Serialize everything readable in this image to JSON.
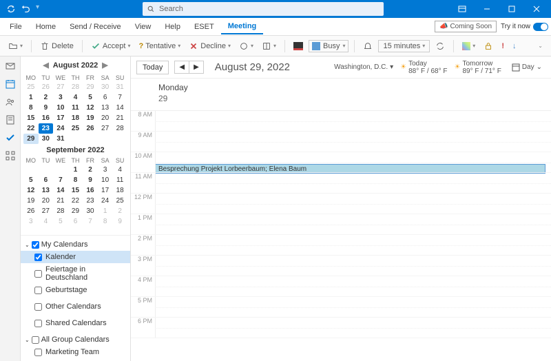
{
  "titlebar": {
    "search_placeholder": "Search"
  },
  "menubar": {
    "items": [
      "File",
      "Home",
      "Send / Receive",
      "View",
      "Help",
      "ESET",
      "Meeting"
    ],
    "active": "Meeting",
    "coming_soon": "Coming Soon",
    "try_it": "Try it now"
  },
  "ribbon": {
    "delete": "Delete",
    "accept": "Accept",
    "tentative": "Tentative",
    "decline": "Decline",
    "busy": "Busy",
    "reminder": "15 minutes"
  },
  "calendar": {
    "month1_title": "August 2022",
    "month2_title": "September 2022",
    "weekdays": [
      "MO",
      "TU",
      "WE",
      "TH",
      "FR",
      "SA",
      "SU"
    ],
    "month1_weeks": [
      [
        {
          "n": 25,
          "o": 1
        },
        {
          "n": 26,
          "o": 1
        },
        {
          "n": 27,
          "o": 1
        },
        {
          "n": 28,
          "o": 1
        },
        {
          "n": 29,
          "o": 1
        },
        {
          "n": 30,
          "o": 1
        },
        {
          "n": 31,
          "o": 1
        }
      ],
      [
        {
          "n": 1,
          "b": 1
        },
        {
          "n": 2,
          "b": 1
        },
        {
          "n": 3,
          "b": 1
        },
        {
          "n": 4,
          "b": 1
        },
        {
          "n": 5,
          "b": 1
        },
        {
          "n": 6
        },
        {
          "n": 7
        }
      ],
      [
        {
          "n": 8,
          "b": 1
        },
        {
          "n": 9,
          "b": 1
        },
        {
          "n": 10,
          "b": 1
        },
        {
          "n": 11,
          "b": 1
        },
        {
          "n": 12,
          "b": 1
        },
        {
          "n": 13
        },
        {
          "n": 14
        }
      ],
      [
        {
          "n": 15,
          "b": 1
        },
        {
          "n": 16,
          "b": 1
        },
        {
          "n": 17,
          "b": 1
        },
        {
          "n": 18,
          "b": 1
        },
        {
          "n": 19,
          "b": 1
        },
        {
          "n": 20
        },
        {
          "n": 21
        }
      ],
      [
        {
          "n": 22,
          "b": 1
        },
        {
          "n": 23,
          "b": 1,
          "t": 1
        },
        {
          "n": 24,
          "b": 1
        },
        {
          "n": 25,
          "b": 1
        },
        {
          "n": 26,
          "b": 1
        },
        {
          "n": 27
        },
        {
          "n": 28
        }
      ],
      [
        {
          "n": 29,
          "b": 1,
          "s": 1
        },
        {
          "n": 30,
          "b": 1
        },
        {
          "n": 31,
          "b": 1
        },
        {
          "n": "",
          "o": 1
        },
        {
          "n": "",
          "o": 1
        },
        {
          "n": "",
          "o": 1
        },
        {
          "n": "",
          "o": 1
        }
      ]
    ],
    "month2_weeks": [
      [
        {
          "n": "",
          "o": 1
        },
        {
          "n": "",
          "o": 1
        },
        {
          "n": "",
          "o": 1
        },
        {
          "n": 1,
          "b": 1
        },
        {
          "n": 2,
          "b": 1
        },
        {
          "n": 3
        },
        {
          "n": 4
        }
      ],
      [
        {
          "n": 5,
          "b": 1
        },
        {
          "n": 6,
          "b": 1
        },
        {
          "n": 7,
          "b": 1
        },
        {
          "n": 8,
          "b": 1
        },
        {
          "n": 9,
          "b": 1
        },
        {
          "n": 10
        },
        {
          "n": 11
        }
      ],
      [
        {
          "n": 12,
          "b": 1
        },
        {
          "n": 13,
          "b": 1
        },
        {
          "n": 14,
          "b": 1
        },
        {
          "n": 15,
          "b": 1
        },
        {
          "n": 16,
          "b": 1
        },
        {
          "n": 17
        },
        {
          "n": 18
        }
      ],
      [
        {
          "n": 19
        },
        {
          "n": 20
        },
        {
          "n": 21
        },
        {
          "n": 22
        },
        {
          "n": 23
        },
        {
          "n": 24
        },
        {
          "n": 25
        }
      ],
      [
        {
          "n": 26
        },
        {
          "n": 27
        },
        {
          "n": 28
        },
        {
          "n": 29
        },
        {
          "n": 30
        },
        {
          "n": 1,
          "o": 1
        },
        {
          "n": 2,
          "o": 1
        }
      ],
      [
        {
          "n": 3,
          "o": 1
        },
        {
          "n": 4,
          "o": 1
        },
        {
          "n": 5,
          "o": 1
        },
        {
          "n": 6,
          "o": 1
        },
        {
          "n": 7,
          "o": 1
        },
        {
          "n": 8,
          "o": 1
        },
        {
          "n": 9,
          "o": 1
        }
      ]
    ]
  },
  "groups": {
    "my_calendars": "My Calendars",
    "kalender": "Kalender",
    "feiertage": "Feiertage in Deutschland",
    "geburtstage": "Geburtstage",
    "other": "Other Calendars",
    "shared": "Shared Calendars",
    "allgroup": "All Group Calendars",
    "marketing": "Marketing Team"
  },
  "main": {
    "today_btn": "Today",
    "date_title": "August 29, 2022",
    "location": "Washington, D.C.",
    "weather_today_label": "Today",
    "weather_today_temp": "88° F / 68° F",
    "weather_tomorrow_label": "Tomorrow",
    "weather_tomorrow_temp": "89° F / 71° F",
    "view": "Day",
    "day_name": "Monday",
    "day_num": "29",
    "hours": [
      "8 AM",
      "9 AM",
      "10 AM",
      "11 AM",
      "12 PM",
      "1 PM",
      "2 PM",
      "3 PM",
      "4 PM",
      "5 PM",
      "6 PM"
    ],
    "event_title": "Besprechung Projekt Lorbeerbaum; Elena Baum"
  }
}
